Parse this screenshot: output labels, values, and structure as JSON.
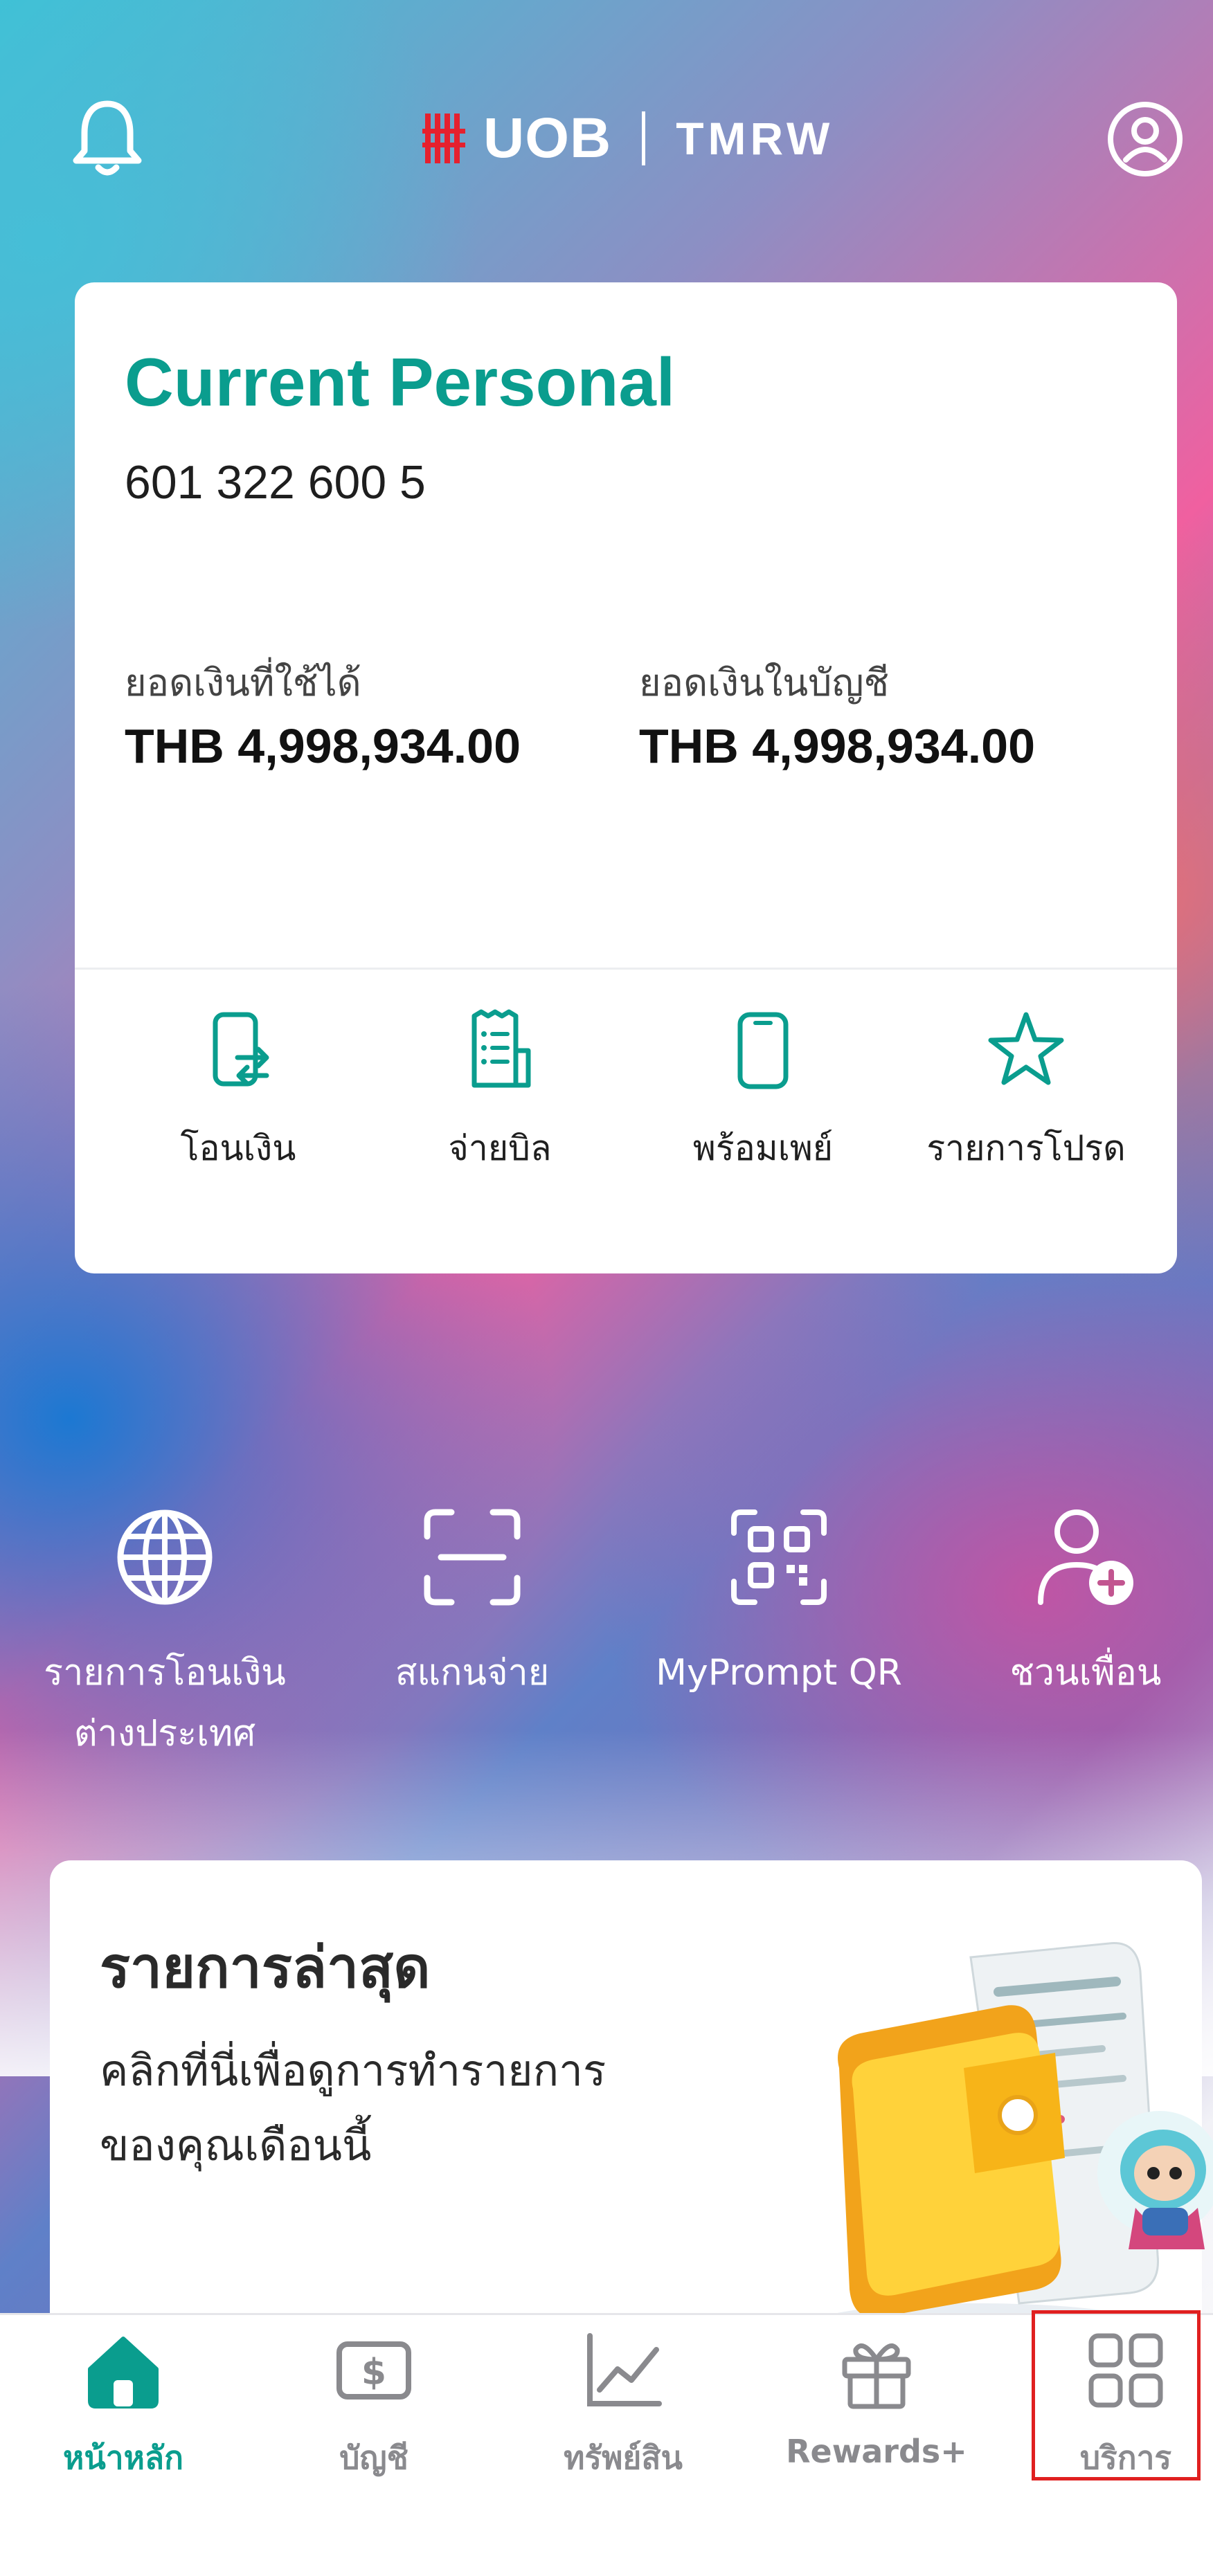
{
  "header": {
    "logo_left": "UOB",
    "logo_right": "TMRW",
    "icons": [
      "bell-icon",
      "profile-icon"
    ]
  },
  "account": {
    "name": "Current Personal",
    "number": "601 322 600 5",
    "available_label": "ยอดเงินที่ใช้ได้",
    "available_value": "THB 4,998,934.00",
    "balance_label": "ยอดเงินในบัญชี",
    "balance_value": "THB 4,998,934.00"
  },
  "quick_actions": [
    {
      "label": "โอนเงิน",
      "icon": "transfer-icon"
    },
    {
      "label": "จ่ายบิล",
      "icon": "bill-icon"
    },
    {
      "label": "พร้อมเพย์",
      "icon": "promptpay-icon"
    },
    {
      "label": "รายการโปรด",
      "icon": "star-icon"
    }
  ],
  "shortcuts": [
    {
      "line1": "รายการโอนเงิน",
      "line2": "ต่างประเทศ",
      "icon": "globe-icon"
    },
    {
      "line1": "สแกนจ่าย",
      "icon": "scan-icon"
    },
    {
      "line1": "MyPrompt QR",
      "icon": "qr-icon"
    },
    {
      "line1": "ชวนเพื่อน",
      "icon": "add-friend-icon"
    }
  ],
  "recent": {
    "title": "รายการล่าสุด",
    "subtitle_line1": "คลิกที่นี่เพื่อดูการทำรายการ",
    "subtitle_line2": "ของคุณเดือนนี้"
  },
  "nav": [
    {
      "label": "หน้าหลัก",
      "icon": "home-icon",
      "active": true
    },
    {
      "label": "บัญชี",
      "icon": "account-icon"
    },
    {
      "label": "ทรัพย์สิน",
      "icon": "chart-icon"
    },
    {
      "label": "Rewards+",
      "icon": "gift-icon"
    },
    {
      "label": "บริการ",
      "icon": "grid-icon",
      "highlighted": true
    }
  ],
  "colors": {
    "accent": "#0a9d8e",
    "highlight": "#e02020",
    "logo_red": "#e5202e"
  }
}
